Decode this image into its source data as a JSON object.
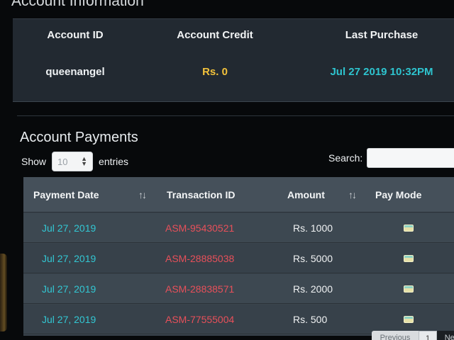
{
  "account_info": {
    "title": "Account Information",
    "headers": {
      "id": "Account ID",
      "credit": "Account Credit",
      "last_purchase": "Last Purchase"
    },
    "row": {
      "id": "queenangel",
      "credit": "Rs. 0",
      "last_purchase": "Jul 27 2019 10:32PM"
    }
  },
  "payments": {
    "title": "Account Payments",
    "length": {
      "show_label": "Show",
      "value": "10",
      "entries_label": "entries"
    },
    "search": {
      "label": "Search:",
      "value": ""
    },
    "headers": {
      "date": "Payment Date",
      "tx": "Transaction ID",
      "amount": "Amount",
      "mode": "Pay Mode"
    },
    "rows": [
      {
        "date": "Jul 27, 2019",
        "tx": "ASM-95430521",
        "amount": "Rs. 1000",
        "mode_icon": "cash-icon"
      },
      {
        "date": "Jul 27, 2019",
        "tx": "ASM-28885038",
        "amount": "Rs. 5000",
        "mode_icon": "cash-icon"
      },
      {
        "date": "Jul 27, 2019",
        "tx": "ASM-28838571",
        "amount": "Rs. 2000",
        "mode_icon": "cash-icon"
      },
      {
        "date": "Jul 27, 2019",
        "tx": "ASM-77555004",
        "amount": "Rs. 500",
        "mode_icon": "cash-icon"
      }
    ],
    "pagination": {
      "previous": "Previous",
      "current": "1",
      "next": "Next"
    }
  },
  "colors": {
    "accent": "#32c7d3",
    "credit": "#f3c23b",
    "transaction": "#e8505a"
  }
}
